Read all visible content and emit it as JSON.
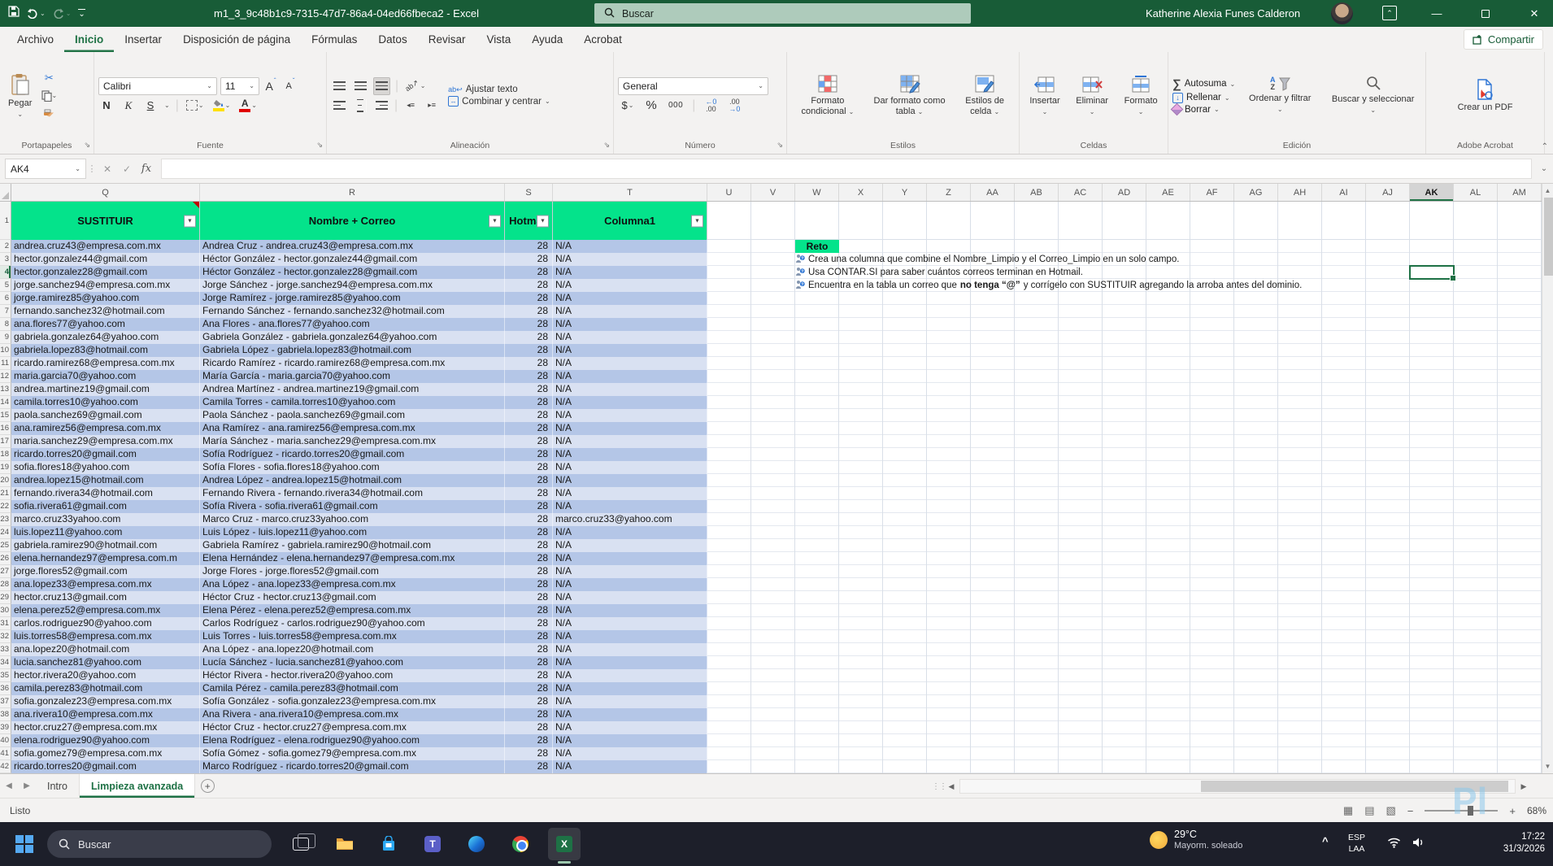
{
  "window": {
    "title": "m1_3_9c48b1c9-7315-47d7-86a4-04ed66fbeca2  -  Excel",
    "search_label": "Buscar",
    "user_name": "Katherine Alexia  Funes Calderon"
  },
  "tabs": {
    "items": [
      "Archivo",
      "Inicio",
      "Insertar",
      "Disposición de página",
      "Fórmulas",
      "Datos",
      "Revisar",
      "Vista",
      "Ayuda",
      "Acrobat"
    ],
    "active": "Inicio",
    "share_label": "Compartir"
  },
  "ribbon": {
    "paste": "Pegar",
    "font_name": "Calibri",
    "font_size": "11",
    "font_letter": "A",
    "bold": "N",
    "italic": "K",
    "underline": "S",
    "wrap_text": "Ajustar texto",
    "merge_center": "Combinar y centrar",
    "number_format": "General",
    "currency_label": "$",
    "percent_label": "%",
    "comma_label": "000",
    "conditional_formatting": "Formato condicional",
    "format_as_table": "Dar formato como tabla",
    "cell_styles": "Estilos de celda",
    "insert": "Insertar",
    "delete": "Eliminar",
    "format": "Formato",
    "autosum": "Autosuma",
    "fill": "Rellenar",
    "clear": "Borrar",
    "sort_filter": "Ordenar y filtrar",
    "find_select": "Buscar y seleccionar",
    "create_pdf": "Crear un PDF",
    "groups": [
      "Portapapeles",
      "Fuente",
      "Alineación",
      "Número",
      "Estilos",
      "Celdas",
      "Edición",
      "Adobe Acrobat"
    ]
  },
  "formula_bar": {
    "name_box": "AK4",
    "fx": "fx",
    "value": ""
  },
  "grid": {
    "columns": [
      "Q",
      "R",
      "S",
      "T",
      "U",
      "V",
      "W",
      "X",
      "Y",
      "Z",
      "AA",
      "AB",
      "AC",
      "AD",
      "AE",
      "AF",
      "AG",
      "AH",
      "AI",
      "AJ",
      "AK",
      "AL",
      "AM"
    ],
    "selected_column": "AK",
    "selected_row": 4,
    "row_count": 42,
    "table": {
      "headers": [
        "SUSTITUIR",
        "Nombre + Correo",
        "Hotmail",
        "Columna1"
      ],
      "rows": [
        [
          "andrea.cruz43@empresa.com.mx",
          "Andrea Cruz - andrea.cruz43@empresa.com.mx",
          "28",
          "N/A"
        ],
        [
          "hector.gonzalez44@gmail.com",
          "Héctor González - hector.gonzalez44@gmail.com",
          "28",
          "N/A"
        ],
        [
          "hector.gonzalez28@gmail.com",
          "Héctor González - hector.gonzalez28@gmail.com",
          "28",
          "N/A"
        ],
        [
          "jorge.sanchez94@empresa.com.mx",
          "Jorge Sánchez - jorge.sanchez94@empresa.com.mx",
          "28",
          "N/A"
        ],
        [
          "jorge.ramirez85@yahoo.com",
          "Jorge Ramírez - jorge.ramirez85@yahoo.com",
          "28",
          "N/A"
        ],
        [
          "fernando.sanchez32@hotmail.com",
          "Fernando Sánchez - fernando.sanchez32@hotmail.com",
          "28",
          "N/A"
        ],
        [
          "ana.flores77@yahoo.com",
          "Ana Flores - ana.flores77@yahoo.com",
          "28",
          "N/A"
        ],
        [
          "gabriela.gonzalez64@yahoo.com",
          "Gabriela González - gabriela.gonzalez64@yahoo.com",
          "28",
          "N/A"
        ],
        [
          "gabriela.lopez83@hotmail.com",
          "Gabriela López - gabriela.lopez83@hotmail.com",
          "28",
          "N/A"
        ],
        [
          "ricardo.ramirez68@empresa.com.mx",
          "Ricardo Ramírez - ricardo.ramirez68@empresa.com.mx",
          "28",
          "N/A"
        ],
        [
          "maria.garcia70@yahoo.com",
          "María García - maria.garcia70@yahoo.com",
          "28",
          "N/A"
        ],
        [
          "andrea.martinez19@gmail.com",
          "Andrea Martínez - andrea.martinez19@gmail.com",
          "28",
          "N/A"
        ],
        [
          "camila.torres10@yahoo.com",
          "Camila Torres - camila.torres10@yahoo.com",
          "28",
          "N/A"
        ],
        [
          "paola.sanchez69@gmail.com",
          "Paola Sánchez - paola.sanchez69@gmail.com",
          "28",
          "N/A"
        ],
        [
          "ana.ramirez56@empresa.com.mx",
          "Ana Ramírez - ana.ramirez56@empresa.com.mx",
          "28",
          "N/A"
        ],
        [
          "maria.sanchez29@empresa.com.mx",
          "María Sánchez - maria.sanchez29@empresa.com.mx",
          "28",
          "N/A"
        ],
        [
          "ricardo.torres20@gmail.com",
          "Sofía Rodríguez - ricardo.torres20@gmail.com",
          "28",
          "N/A"
        ],
        [
          "sofia.flores18@yahoo.com",
          "Sofía Flores - sofia.flores18@yahoo.com",
          "28",
          "N/A"
        ],
        [
          "andrea.lopez15@hotmail.com",
          "Andrea López - andrea.lopez15@hotmail.com",
          "28",
          "N/A"
        ],
        [
          "fernando.rivera34@hotmail.com",
          "Fernando Rivera - fernando.rivera34@hotmail.com",
          "28",
          "N/A"
        ],
        [
          "sofia.rivera61@gmail.com",
          "Sofía Rivera - sofia.rivera61@gmail.com",
          "28",
          "N/A"
        ],
        [
          "marco.cruz33yahoo.com",
          "Marco Cruz - marco.cruz33yahoo.com",
          "28",
          "marco.cruz33@yahoo.com"
        ],
        [
          "luis.lopez11@yahoo.com",
          "Luis López - luis.lopez11@yahoo.com",
          "28",
          "N/A"
        ],
        [
          "gabriela.ramirez90@hotmail.com",
          "Gabriela Ramírez - gabriela.ramirez90@hotmail.com",
          "28",
          "N/A"
        ],
        [
          "elena.hernandez97@empresa.com.m",
          "Elena Hernández - elena.hernandez97@empresa.com.mx",
          "28",
          "N/A"
        ],
        [
          "jorge.flores52@gmail.com",
          "Jorge Flores - jorge.flores52@gmail.com",
          "28",
          "N/A"
        ],
        [
          "ana.lopez33@empresa.com.mx",
          "Ana López - ana.lopez33@empresa.com.mx",
          "28",
          "N/A"
        ],
        [
          "hector.cruz13@gmail.com",
          "Héctor Cruz - hector.cruz13@gmail.com",
          "28",
          "N/A"
        ],
        [
          "elena.perez52@empresa.com.mx",
          "Elena Pérez - elena.perez52@empresa.com.mx",
          "28",
          "N/A"
        ],
        [
          "carlos.rodriguez90@yahoo.com",
          "Carlos Rodríguez - carlos.rodriguez90@yahoo.com",
          "28",
          "N/A"
        ],
        [
          "luis.torres58@empresa.com.mx",
          "Luis Torres - luis.torres58@empresa.com.mx",
          "28",
          "N/A"
        ],
        [
          "ana.lopez20@hotmail.com",
          "Ana López - ana.lopez20@hotmail.com",
          "28",
          "N/A"
        ],
        [
          "lucia.sanchez81@yahoo.com",
          "Lucía Sánchez - lucia.sanchez81@yahoo.com",
          "28",
          "N/A"
        ],
        [
          "hector.rivera20@yahoo.com",
          "Héctor Rivera - hector.rivera20@yahoo.com",
          "28",
          "N/A"
        ],
        [
          "camila.perez83@hotmail.com",
          "Camila Pérez - camila.perez83@hotmail.com",
          "28",
          "N/A"
        ],
        [
          "sofia.gonzalez23@empresa.com.mx",
          "Sofía González - sofia.gonzalez23@empresa.com.mx",
          "28",
          "N/A"
        ],
        [
          "ana.rivera10@empresa.com.mx",
          "Ana Rivera - ana.rivera10@empresa.com.mx",
          "28",
          "N/A"
        ],
        [
          "hector.cruz27@empresa.com.mx",
          "Héctor Cruz - hector.cruz27@empresa.com.mx",
          "28",
          "N/A"
        ],
        [
          "elena.rodriguez90@yahoo.com",
          "Elena Rodríguez - elena.rodriguez90@yahoo.com",
          "28",
          "N/A"
        ],
        [
          "sofia.gomez79@empresa.com.mx",
          "Sofía Gómez - sofia.gomez79@empresa.com.mx",
          "28",
          "N/A"
        ],
        [
          "ricardo.torres20@gmail.com",
          "Marco Rodríguez - ricardo.torres20@gmail.com",
          "28",
          "N/A"
        ]
      ]
    },
    "reto": {
      "title": "Reto",
      "items": [
        {
          "runs": [
            {
              "t": "Crea una columna que combine el Nombre_Limpio y el Correo_Limpio en un solo campo."
            }
          ]
        },
        {
          "runs": [
            {
              "t": "Usa CONTAR.SI para saber cuántos correos terminan en Hotmail."
            }
          ]
        },
        {
          "runs": [
            {
              "t": "Encuentra en la tabla un correo que "
            },
            {
              "t": "no tenga “@”",
              "b": true
            },
            {
              "t": " y corrígelo con SUSTITUIR agregando la arroba antes del dominio."
            }
          ]
        }
      ]
    }
  },
  "sheet_tabs": {
    "tabs": [
      "Intro",
      "Limpieza avanzada"
    ],
    "active": "Limpieza avanzada"
  },
  "status_bar": {
    "mode": "Listo",
    "zoom": "68%"
  },
  "taskbar": {
    "search": "Buscar",
    "weather_temp": "29°C",
    "weather_desc": "Mayorm. soleado",
    "lang_top": "ESP",
    "lang_bottom": "LAA",
    "time": "17:22",
    "date": "31/3/2026"
  },
  "colors": {
    "titlebar_green": "#185C37",
    "accent_green": "#217346",
    "table_header_green": "#04E38B",
    "band_dark": "#B4C6E7",
    "band_light": "#D9E1F2",
    "selection_green": "#1E7145"
  },
  "watermark": "Pl"
}
